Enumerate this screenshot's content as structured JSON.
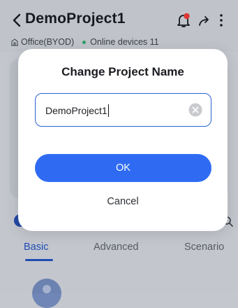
{
  "header": {
    "title": "DemoProject1",
    "office": "Office(BYOD)",
    "online_devices": "Online devices 11"
  },
  "tabs": [
    {
      "label": "Basic",
      "active": true
    },
    {
      "label": "Advanced",
      "active": false
    },
    {
      "label": "Scenario",
      "active": false
    }
  ],
  "dialog": {
    "title": "Change Project Name",
    "input_value": "DemoProject1",
    "ok_label": "OK",
    "cancel_label": "Cancel"
  },
  "colors": {
    "primary": "#2f6bf2",
    "accent_border": "#2c63d6",
    "online_dot": "#2ea36a",
    "notification_badge": "#e53935"
  },
  "icons": [
    "back-icon",
    "bell-icon",
    "share-icon",
    "more-icon",
    "office-icon",
    "clear-icon"
  ]
}
